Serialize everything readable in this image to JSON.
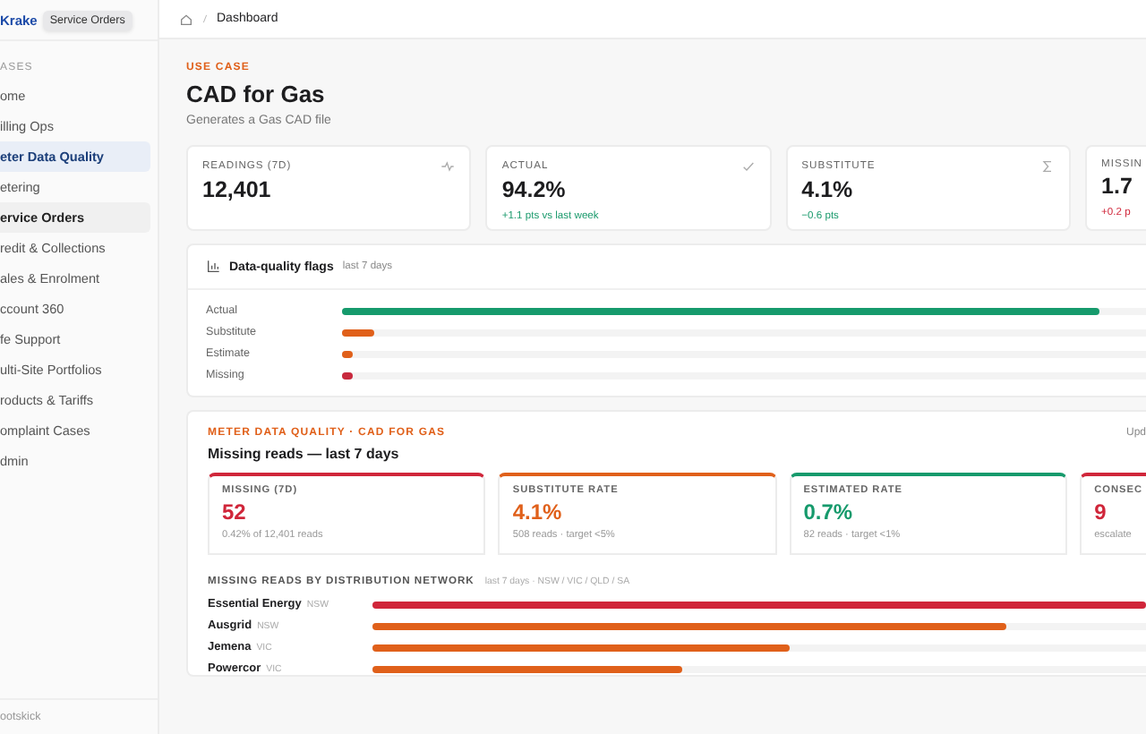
{
  "sidebar": {
    "logo": "Krake",
    "tooltip": "Service Orders",
    "section": "ASES",
    "items": [
      {
        "label": "ome",
        "selected": false,
        "hovered": false
      },
      {
        "label": "illing Ops",
        "selected": false,
        "hovered": false
      },
      {
        "label": "eter Data Quality",
        "selected": true,
        "hovered": false
      },
      {
        "label": "etering",
        "selected": false,
        "hovered": false
      },
      {
        "label": "ervice Orders",
        "selected": false,
        "hovered": true
      },
      {
        "label": "redit & Collections",
        "selected": false,
        "hovered": false
      },
      {
        "label": "ales & Enrolment",
        "selected": false,
        "hovered": false
      },
      {
        "label": "ccount 360",
        "selected": false,
        "hovered": false
      },
      {
        "label": "fe Support",
        "selected": false,
        "hovered": false
      },
      {
        "label": "ulti-Site Portfolios",
        "selected": false,
        "hovered": false
      },
      {
        "label": "roducts & Tariffs",
        "selected": false,
        "hovered": false
      },
      {
        "label": "omplaint Cases",
        "selected": false,
        "hovered": false
      },
      {
        "label": "dmin",
        "selected": false,
        "hovered": false
      }
    ],
    "footer": "ootskick"
  },
  "breadcrumb": "Dashboard",
  "page": {
    "eyebrow": "USE CASE",
    "title": "CAD for Gas",
    "subtitle": "Generates a Gas CAD file"
  },
  "kpis": [
    {
      "label": "READINGS (7D)",
      "value": "12,401"
    },
    {
      "label": "ACTUAL",
      "value": "94.2%",
      "delta": "+1.1 pts vs last week",
      "kind": "positive"
    },
    {
      "label": "SUBSTITUTE",
      "value": "4.1%",
      "delta": "−0.6 pts",
      "kind": "positive"
    },
    {
      "label": "MISSIN",
      "value": "1.7",
      "delta": "+0.2 p",
      "kind": "negative"
    }
  ],
  "flags": {
    "title": "Data-quality flags",
    "period": "last 7 days",
    "rows": [
      {
        "label": "Actual",
        "level": 0.942,
        "color": "#169a6c"
      },
      {
        "label": "Substitute",
        "level": 0.041,
        "color": "#e0601a"
      },
      {
        "label": "Estimate",
        "level": 0.012,
        "color": "#e0601a"
      },
      {
        "label": "Missing",
        "level": 0.012,
        "color": "#c8293d"
      }
    ]
  },
  "missing": {
    "eyebrow": "METER DATA QUALITY · CAD FOR GAS",
    "title": "Missing reads — last 7 days",
    "updated": "Upd",
    "stats": [
      {
        "label": "MISSING (7D)",
        "value": "52",
        "note": "0.42% of 12,401 reads",
        "color": "#d0263a"
      },
      {
        "label": "SUBSTITUTE RATE",
        "value": "4.1%",
        "note": "508 reads · target <5%",
        "color": "#e0601a"
      },
      {
        "label": "ESTIMATED RATE",
        "value": "0.7%",
        "note": "82 reads · target <1%",
        "color": "#169a6c"
      },
      {
        "label": "CONSEC",
        "value": "9",
        "note": "escalate",
        "color": "#d0263a"
      }
    ],
    "network_title": "MISSING READS BY DISTRIBUTION NETWORK",
    "network_scope": "last 7 days · NSW / VIC / QLD / SA",
    "networks": [
      {
        "name": "Essential Energy",
        "state": "NSW",
        "level": 1.0,
        "color": "#d0263a"
      },
      {
        "name": "Ausgrid",
        "state": "NSW",
        "level": 0.82,
        "color": "#e0601a"
      },
      {
        "name": "Jemena",
        "state": "VIC",
        "level": 0.54,
        "color": "#e0601a"
      },
      {
        "name": "Powercor",
        "state": "VIC",
        "level": 0.4,
        "color": "#e0601a"
      }
    ]
  }
}
